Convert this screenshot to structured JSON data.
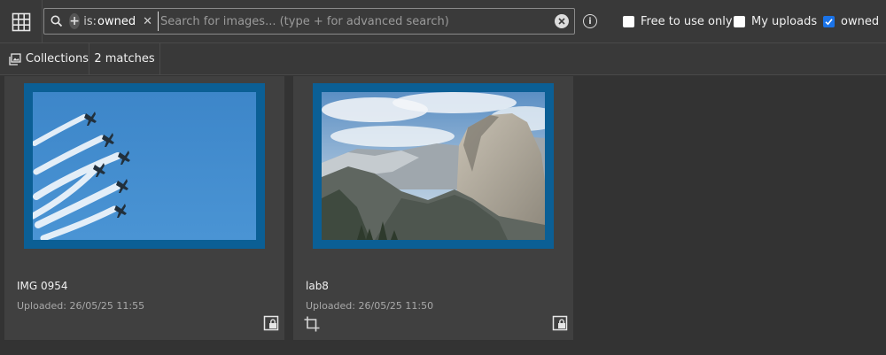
{
  "search": {
    "chip_key": "is:",
    "chip_value": "owned",
    "placeholder": "Search for images... (type + for advanced search)",
    "value": ""
  },
  "filters": {
    "free_to_use": {
      "label": "Free to use only",
      "checked": false
    },
    "my_uploads": {
      "label": "My uploads",
      "checked": false
    },
    "owned": {
      "label": "owned",
      "checked": true
    }
  },
  "toolbar": {
    "collections_label": "Collections",
    "matches_label": "2 matches"
  },
  "results": [
    {
      "title": "IMG 0954",
      "uploaded": "Uploaded: 26/05/25 11:55",
      "cropped": false,
      "image": "jets-formation-blue-sky"
    },
    {
      "title": "lab8",
      "uploaded": "Uploaded: 26/05/25 11:50",
      "cropped": true,
      "image": "half-dome-mountain"
    }
  ],
  "colors": {
    "accent": "#0b5f95",
    "checkbox_checked": "#1a73e8",
    "background": "#333333",
    "card": "#404040"
  },
  "icons": [
    "grid-icon",
    "search-icon",
    "plus-icon",
    "close-icon",
    "clear-icon",
    "info-icon",
    "collections-icon",
    "lock-icon",
    "crop-icon"
  ]
}
